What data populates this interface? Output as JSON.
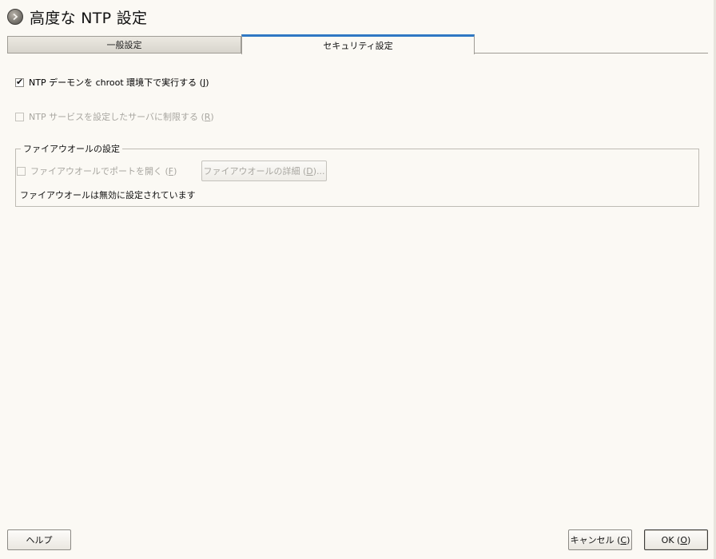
{
  "window": {
    "title": "高度な NTP 設定"
  },
  "tabs": [
    {
      "label": "一般設定",
      "active": false
    },
    {
      "label": "セキュリティ設定",
      "active": true
    }
  ],
  "options": {
    "chroot": {
      "label_prefix": "NTP デーモンを chroot 環境下で実行する (",
      "shortcut": "J",
      "label_suffix": ")",
      "checked": true,
      "enabled": true
    },
    "restrict": {
      "label_prefix": "NTP サービスを設定したサーバに制限する (",
      "shortcut": "R",
      "label_suffix": ")",
      "checked": false,
      "enabled": false
    }
  },
  "firewall": {
    "group_title": "ファイアウオールの設定",
    "open_port": {
      "label_prefix": "ファイアウオールでポートを開く (",
      "shortcut": "F",
      "label_suffix": ")",
      "checked": false,
      "enabled": false
    },
    "details_button": {
      "label_prefix": "ファイアウオールの詳細 (",
      "shortcut": "D",
      "label_suffix": ")..."
    },
    "status": "ファイアウオールは無効に設定されています"
  },
  "footer": {
    "help_label": "ヘルプ",
    "cancel": {
      "label_prefix": "キャンセル (",
      "shortcut": "C",
      "label_suffix": ")"
    },
    "ok": {
      "label_prefix": "OK (",
      "shortcut": "O",
      "label_suffix": ")"
    }
  },
  "icons": {
    "title": "arrow-right-circle-icon",
    "check": "checkmark-icon"
  },
  "colors": {
    "background": "#fbf9f4",
    "active_tab_accent": "#2f78c4",
    "disabled_text": "#a8a6a0"
  }
}
